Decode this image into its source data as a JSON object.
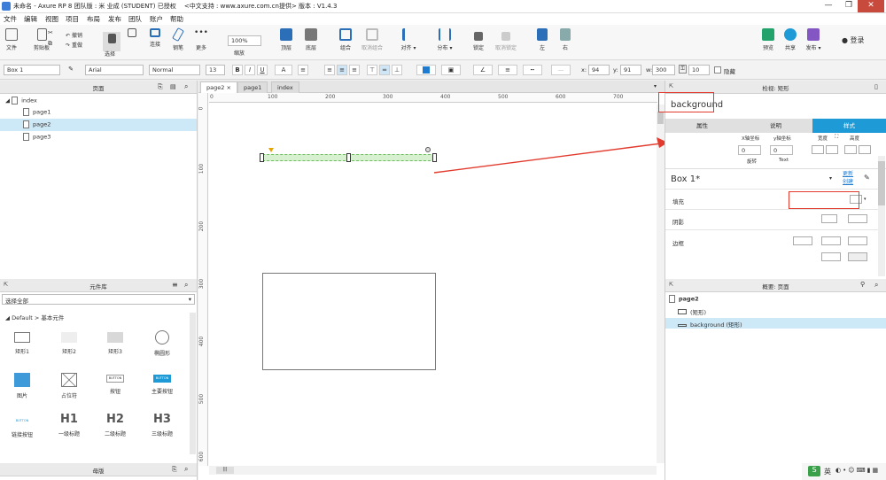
{
  "titlebar": {
    "title": "未命名 - Axure RP 8 团队版 : 米 业成 (STUDENT) 已授权 　<中文支持 : www.axure.com.cn提供> 版本 : V1.4.3",
    "min": "—",
    "max": "❐",
    "close": "✕"
  },
  "menu": [
    "文件",
    "编辑",
    "视图",
    "项目",
    "布局",
    "发布",
    "团队",
    "账户",
    "帮助"
  ],
  "toolbar": {
    "file": "文件",
    "clipboard": "剪贴板",
    "cut": "✂",
    "copy": "⧉",
    "undo": "撤销",
    "redo": "重做",
    "select": "选择",
    "connect": "连接",
    "pen": "钢笔",
    "more": "更多",
    "zoom": "100%",
    "zoom_label": "缩放",
    "top": "顶层",
    "bottom": "底层",
    "group": "组合",
    "ungroup": "取消组合",
    "align": "对齐",
    "distribute": "分布",
    "lock": "锁定",
    "unlock": "取消锁定",
    "left": "左",
    "right": "右",
    "preview": "预览",
    "share": "共享",
    "publish": "发布",
    "login": "登录"
  },
  "format": {
    "name": "Box 1",
    "font": "Arial",
    "weight": "Normal",
    "size": "13",
    "x_label": "x:",
    "x": "94",
    "y_label": "y:",
    "y": "91",
    "w_label": "w:",
    "w": "300",
    "h_label": "h:",
    "h": "10",
    "hidden": "隐藏",
    "bold": "B",
    "italic": "I",
    "underline": "U",
    "fontcolor": "A"
  },
  "pages_panel": {
    "title": "页面",
    "root": "index",
    "items": [
      "page1",
      "page2",
      "page3"
    ],
    "selected": "page2"
  },
  "library": {
    "title": "元件库",
    "select_all": "选择全部",
    "group": "Default > 基本元件",
    "items": [
      "矩形1",
      "矩形2",
      "矩形3",
      "椭圆形",
      "图片",
      "占位符",
      "按钮",
      "主要按钮",
      "链接按钮",
      "一级标题",
      "二级标题",
      "三级标题"
    ],
    "button_text": "BUTTON",
    "h1": "H1",
    "h2": "H2",
    "h3": "H3"
  },
  "masters": {
    "title": "母版"
  },
  "canvas": {
    "tabs": [
      "page2",
      "page1",
      "index"
    ],
    "ruler_h": [
      "0",
      "100",
      "200",
      "300",
      "400",
      "500",
      "600",
      "700"
    ],
    "ruler_v": [
      "0",
      "100",
      "200",
      "300",
      "400",
      "500",
      "600"
    ],
    "scroll_label": "|||"
  },
  "inspector": {
    "header": "检视: 矩形",
    "name": "background",
    "tabs": [
      "属性",
      "说明",
      "样式"
    ],
    "x_rot_label": "X轴坐标",
    "y_rot_label": "y轴坐标",
    "width_label": "宽度",
    "height_label": "高度",
    "rot": "0",
    "text_rot": "0",
    "rot_label": "旋转",
    "text_label": "Text",
    "style_name": "Box 1*",
    "style_link1": "更新",
    "style_link2": "创建",
    "fill": "填充",
    "shadow": "阴影",
    "border": "边框"
  },
  "outline": {
    "title": "概要: 页面",
    "page": "page2",
    "items": [
      "(矩形)",
      "background (矩形)"
    ]
  },
  "status": {
    "ime": "英"
  },
  "colors": {
    "accent": "#1e9ad6",
    "selected_row": "#cde8f7",
    "arrow": "#e23b2e"
  }
}
